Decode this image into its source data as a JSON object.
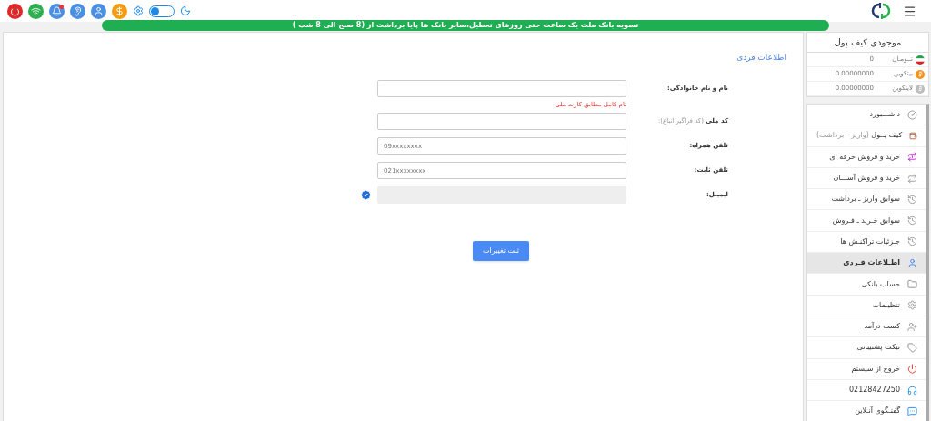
{
  "header": {
    "theme_toggle": {
      "on": false
    }
  },
  "banner": "تسویه بانک ملت یک ساعت حتی روزهای تعطیل،سایر بانک ها پایا برداشت از (8 صبح الی 8 شب )",
  "wallet": {
    "title": "موجودی کیف پول",
    "rows": [
      {
        "label": "تــومـان",
        "value": "0"
      },
      {
        "label": "بیتکوین",
        "value": "0.00000000"
      },
      {
        "label": "لایتکوین",
        "value": "0.00000000"
      }
    ]
  },
  "menu": [
    {
      "label": "داشـــبورد",
      "selected": false
    },
    {
      "label": "کیف پــول",
      "note": "(واریز - برداشت)",
      "selected": false
    },
    {
      "label": "خرید و فروش حرفه ای",
      "selected": false
    },
    {
      "label": "خرید و فروش آســـان",
      "selected": false
    },
    {
      "label": "سوابق واریز ـ برداشت",
      "selected": false
    },
    {
      "label": "سوابق خـرید ـ فـروش",
      "selected": false
    },
    {
      "label": "جـزئیات تراکنـش ها",
      "selected": false
    },
    {
      "label": "اطـلاعات فـردی",
      "selected": true
    },
    {
      "label": "حساب بانکی",
      "selected": false
    },
    {
      "label": "تنظیـمات",
      "selected": false
    },
    {
      "label": "کسب درآمد",
      "selected": false
    },
    {
      "label": "تیکت پشتیبانی",
      "selected": false
    },
    {
      "label": "خروج از سیستم",
      "selected": false
    },
    {
      "label": "02128427250",
      "selected": false
    },
    {
      "label": "گفتـگوی آنـلاین",
      "selected": false
    }
  ],
  "form": {
    "title": "اطلاعات فردی",
    "fields": [
      {
        "label": "نام و نام خانوادگی:",
        "hint": "نام کامل مطابق کارت ملی",
        "disabled": false,
        "verified": false
      },
      {
        "label": "کد ملی",
        "note": "(کد فراگیر اتباع):",
        "disabled": false,
        "verified": false
      },
      {
        "label": "تلفن همراه:",
        "placeholder": "09xxxxxxxx",
        "disabled": false,
        "verified": false
      },
      {
        "label": "تلفن ثابت:",
        "placeholder": "021xxxxxxxx",
        "disabled": false,
        "verified": false
      },
      {
        "label": "ایمیـل:",
        "disabled": true,
        "verified": true
      }
    ],
    "submit": "ثبت تغییرات"
  }
}
